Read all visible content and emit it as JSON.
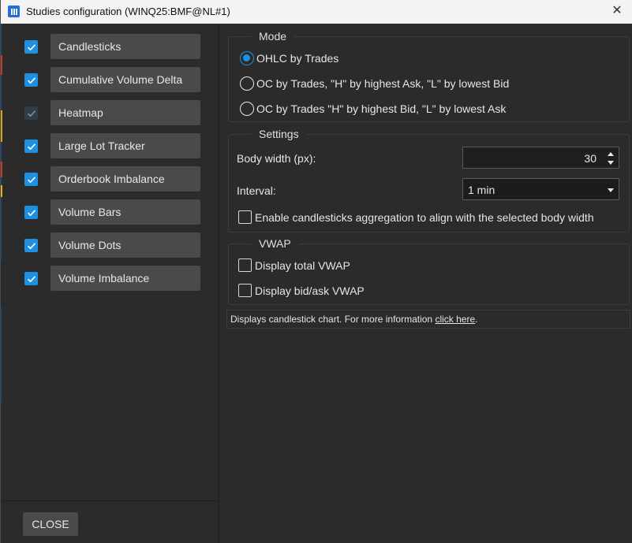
{
  "window": {
    "title": "Studies configuration (WINQ25:BMF@NL#1)",
    "close_glyph": "✕"
  },
  "studies": [
    {
      "label": "Candlesticks",
      "checked": true,
      "dim": false
    },
    {
      "label": "Cumulative Volume Delta",
      "checked": true,
      "dim": false
    },
    {
      "label": "Heatmap",
      "checked": true,
      "dim": true
    },
    {
      "label": "Large Lot Tracker",
      "checked": true,
      "dim": false
    },
    {
      "label": "Orderbook Imbalance",
      "checked": true,
      "dim": false
    },
    {
      "label": "Volume Bars",
      "checked": true,
      "dim": false
    },
    {
      "label": "Volume Dots",
      "checked": true,
      "dim": false
    },
    {
      "label": "Volume Imbalance",
      "checked": true,
      "dim": false
    }
  ],
  "footer": {
    "close_label": "CLOSE"
  },
  "mode": {
    "title": "Mode",
    "options": [
      {
        "label": "OHLC by Trades",
        "selected": true
      },
      {
        "label": "OC by Trades, \"H\" by highest Ask, \"L\" by lowest Bid",
        "selected": false
      },
      {
        "label": "OC by Trades \"H\" by highest Bid, \"L\" by lowest Ask",
        "selected": false
      }
    ]
  },
  "settings": {
    "title": "Settings",
    "body_width_label": "Body width (px):",
    "body_width_value": "30",
    "interval_label": "Interval:",
    "interval_value": "1 min",
    "aggregation_label": "Enable candlesticks aggregation to align with the selected body width"
  },
  "vwap": {
    "title": "VWAP",
    "total_label": "Display total VWAP",
    "bidask_label": "Display bid/ask VWAP"
  },
  "info": {
    "text": "Displays candlestick chart. For more information ",
    "link": "click here",
    "suffix": "."
  },
  "colors": {
    "accent": "#1f8fe0",
    "background": "#2b2b2b",
    "button": "#4a4a4a",
    "titlebar": "#f3f3f3"
  }
}
